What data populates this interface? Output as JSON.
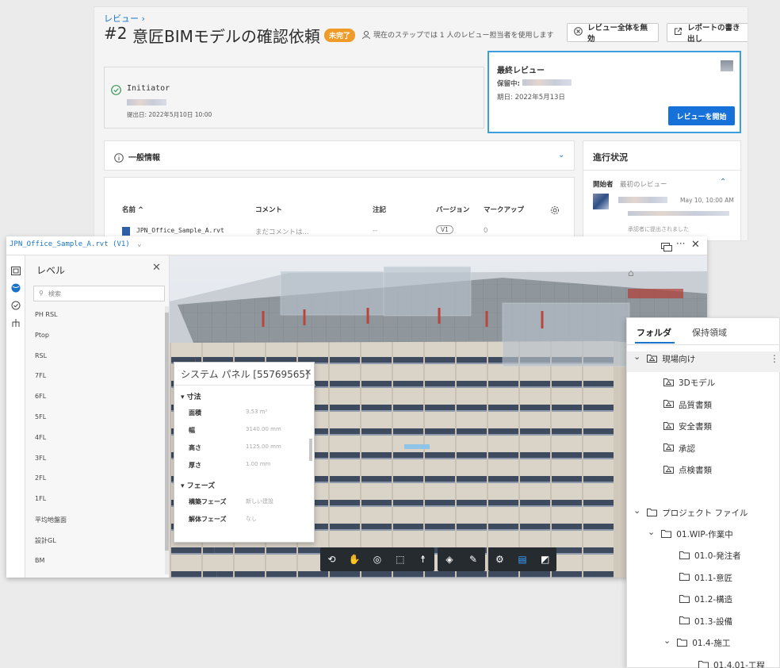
{
  "review": {
    "breadcrumb": "レビュー ›",
    "title_number": "#2",
    "title": "意匠BIMモデルの確認依頼",
    "status_badge": "未完了",
    "step_text": "現在のステップでは 1 人のレビュー担当者を使用します",
    "disable_button": "レビュー全体を無効",
    "export_button": "レポートの書き出し",
    "initiator_label": "Initiator",
    "submitted": "提出日: 2022年5月10日 10:00",
    "final_review_title": "最終レビュー",
    "pending_label": "保留中:",
    "due_date": "期日: 2022年5月13日",
    "start_review_button": "レビューを開始",
    "general_info": "一般情報",
    "progress_title": "進行状況",
    "progress_started_by": "開始者",
    "progress_first_review": "最初のレビュー",
    "progress_time": "May 10, 10:00 AM",
    "progress_note": "承認者に提出されました",
    "table_headers": [
      "名前 ^",
      "コメント",
      "注記",
      "バージョン",
      "マークアップ"
    ],
    "table_rows": [
      {
        "name": "JPN_Office_Sample_A.rvt",
        "comment": "まだコメントは...",
        "notes": "--",
        "version": "V1",
        "markup": "0"
      }
    ]
  },
  "viewer": {
    "file_tab": "JPN_Office_Sample_A.rvt (V1)",
    "level_title": "レベル",
    "search_placeholder": "検索",
    "levels": [
      "PH RSL",
      "Ptop",
      "RSL",
      "7FL",
      "6FL",
      "5FL",
      "4FL",
      "3FL",
      "2FL",
      "1FL",
      "平均地盤面",
      "設計GL",
      "BM"
    ],
    "props_title": "システム パネル [55769565]",
    "props_sections": [
      {
        "name": "寸法",
        "rows": [
          {
            "k": "面積",
            "v": "3.53 m²"
          },
          {
            "k": "幅",
            "v": "3140.00 mm"
          },
          {
            "k": "高さ",
            "v": "1125.00 mm"
          },
          {
            "k": "厚さ",
            "v": "1.00 mm"
          }
        ]
      },
      {
        "name": "フェーズ",
        "rows": [
          {
            "k": "構築フェーズ",
            "v": "新しい建設"
          },
          {
            "k": "解体フェーズ",
            "v": "なし"
          }
        ]
      }
    ]
  },
  "folders": {
    "tabs": [
      "フォルダ",
      "保持領域"
    ],
    "site_group": "現場向け",
    "site_items": [
      "3Dモデル",
      "品質書類",
      "安全書類",
      "承認",
      "点検書類"
    ],
    "project_files": "プロジェクト ファイル",
    "wip": "01.WIP-作業中",
    "wip_items": [
      "01.0-発注者",
      "01.1-意匠",
      "01.2-構造",
      "01.3-設備"
    ],
    "construction": "01.4-施工",
    "construction_items": [
      "01.4.01-工程"
    ]
  },
  "colors": {
    "accent": "#1672d9",
    "badge": "#f09a28",
    "toolbar": "#262b30"
  }
}
